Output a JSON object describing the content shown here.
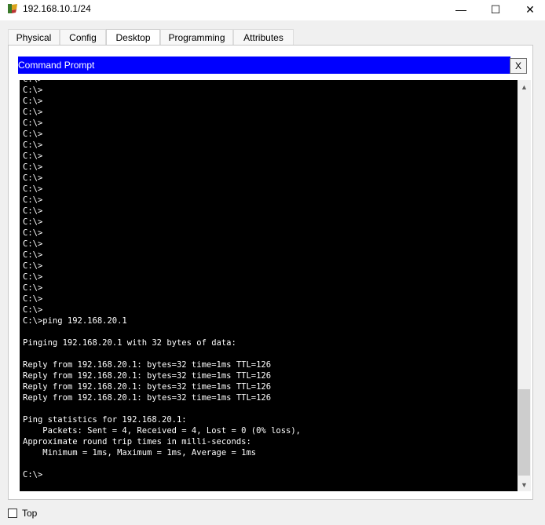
{
  "window": {
    "title": "192.168.10.1/24",
    "minimize_glyph": "—",
    "maximize_glyph": "☐",
    "close_glyph": "✕"
  },
  "tabs": [
    {
      "label": "Physical"
    },
    {
      "label": "Config"
    },
    {
      "label": "Desktop",
      "active": true
    },
    {
      "label": "Programming"
    },
    {
      "label": "Attributes"
    }
  ],
  "command_prompt": {
    "title": "Command Prompt",
    "close_label": "X",
    "terminal_text": "C:\\>\nC:\\>\nC:\\>\nC:\\>\nC:\\>\nC:\\>\nC:\\>\nC:\\>\nC:\\>\nC:\\>\nC:\\>\nC:\\>\nC:\\>\nC:\\>\nC:\\>\nC:\\>\nC:\\>\nC:\\>\nC:\\>\nC:\\>\nC:\\>\nC:\\>\nC:\\>ping 192.168.20.1\n\nPinging 192.168.20.1 with 32 bytes of data:\n\nReply from 192.168.20.1: bytes=32 time=1ms TTL=126\nReply from 192.168.20.1: bytes=32 time=1ms TTL=126\nReply from 192.168.20.1: bytes=32 time=1ms TTL=126\nReply from 192.168.20.1: bytes=32 time=1ms TTL=126\n\nPing statistics for 192.168.20.1:\n    Packets: Sent = 4, Received = 4, Lost = 0 (0% loss),\nApproximate round trip times in milli-seconds:\n    Minimum = 1ms, Maximum = 1ms, Average = 1ms\n\nC:\\>"
  },
  "scrollbar": {
    "up_glyph": "▲",
    "down_glyph": "▼",
    "position_fraction": 1.0
  },
  "footer": {
    "top_label": "Top",
    "top_checked": false
  },
  "colors": {
    "prompt_header": "#0000ff",
    "terminal_bg": "#000000",
    "terminal_fg": "#ffffff"
  },
  "icons": {
    "app": "packet-tracer-pc-icon"
  }
}
